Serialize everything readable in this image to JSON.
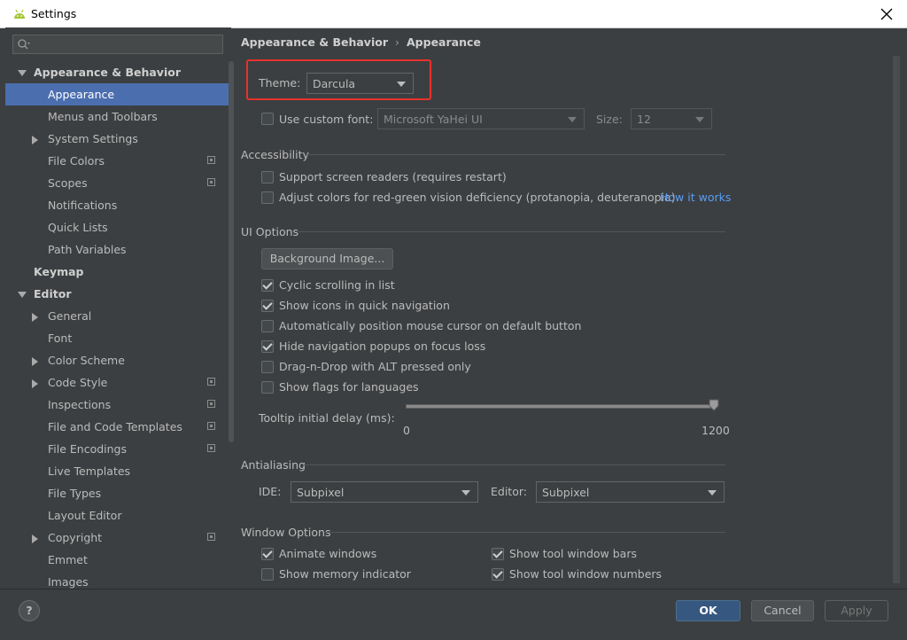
{
  "window": {
    "title": "Settings"
  },
  "sidebar": {
    "search_placeholder": "",
    "items": [
      {
        "label": "Appearance & Behavior",
        "level": 0,
        "arrow": "down",
        "bold": true
      },
      {
        "label": "Appearance",
        "level": 1,
        "selected": true
      },
      {
        "label": "Menus and Toolbars",
        "level": 1
      },
      {
        "label": "System Settings",
        "level": 1,
        "arrow": "right"
      },
      {
        "label": "File Colors",
        "level": 1,
        "project_icon": true
      },
      {
        "label": "Scopes",
        "level": 1,
        "project_icon": true
      },
      {
        "label": "Notifications",
        "level": 1
      },
      {
        "label": "Quick Lists",
        "level": 1
      },
      {
        "label": "Path Variables",
        "level": 1
      },
      {
        "label": "Keymap",
        "level": 0,
        "bold": true
      },
      {
        "label": "Editor",
        "level": 0,
        "arrow": "down",
        "bold": true
      },
      {
        "label": "General",
        "level": 1,
        "arrow": "right"
      },
      {
        "label": "Font",
        "level": 1
      },
      {
        "label": "Color Scheme",
        "level": 1,
        "arrow": "right"
      },
      {
        "label": "Code Style",
        "level": 1,
        "arrow": "right",
        "project_icon": true
      },
      {
        "label": "Inspections",
        "level": 1,
        "project_icon": true
      },
      {
        "label": "File and Code Templates",
        "level": 1,
        "project_icon": true
      },
      {
        "label": "File Encodings",
        "level": 1,
        "project_icon": true
      },
      {
        "label": "Live Templates",
        "level": 1
      },
      {
        "label": "File Types",
        "level": 1
      },
      {
        "label": "Layout Editor",
        "level": 1
      },
      {
        "label": "Copyright",
        "level": 1,
        "arrow": "right",
        "project_icon": true
      },
      {
        "label": "Emmet",
        "level": 1
      },
      {
        "label": "Images",
        "level": 1
      }
    ]
  },
  "breadcrumb": {
    "parent": "Appearance & Behavior",
    "separator": "›",
    "current": "Appearance"
  },
  "theme": {
    "label": "Theme:",
    "value": "Darcula"
  },
  "custom_font": {
    "label": "Use custom font:",
    "checked": false,
    "font_value": "Microsoft YaHei UI",
    "size_label": "Size:",
    "size_value": "12"
  },
  "accessibility": {
    "title": "Accessibility",
    "screen_readers": {
      "label": "Support screen readers (requires restart)",
      "checked": false
    },
    "color_deficiency": {
      "label": "Adjust colors for red-green vision deficiency (protanopia, deuteranopia)",
      "checked": false,
      "link": "How it works"
    }
  },
  "ui_options": {
    "title": "UI Options",
    "background_button": "Background Image...",
    "checkboxes": [
      {
        "label": "Cyclic scrolling in list",
        "checked": true
      },
      {
        "label": "Show icons in quick navigation",
        "checked": true
      },
      {
        "label": "Automatically position mouse cursor on default button",
        "checked": false
      },
      {
        "label": "Hide navigation popups on focus loss",
        "checked": true
      },
      {
        "label": "Drag-n-Drop with ALT pressed only",
        "checked": false
      },
      {
        "label": "Show flags for languages",
        "checked": false
      }
    ],
    "tooltip": {
      "label": "Tooltip initial delay (ms):",
      "min": "0",
      "max": "1200",
      "value": 1200
    }
  },
  "antialiasing": {
    "title": "Antialiasing",
    "ide_label": "IDE:",
    "ide_value": "Subpixel",
    "editor_label": "Editor:",
    "editor_value": "Subpixel"
  },
  "window_options": {
    "title": "Window Options",
    "left": [
      {
        "label": "Animate windows",
        "checked": true
      },
      {
        "label": "Show memory indicator",
        "checked": false
      }
    ],
    "right": [
      {
        "label": "Show tool window bars",
        "checked": true
      },
      {
        "label": "Show tool window numbers",
        "checked": true
      }
    ]
  },
  "footer": {
    "help": "?",
    "ok": "OK",
    "cancel": "Cancel",
    "apply": "Apply"
  },
  "colors": {
    "background": "#3c3f41",
    "selection": "#4b6eaf",
    "link": "#589df6",
    "highlight": "#e8322b",
    "primary_button": "#365880"
  },
  "icons": {
    "app": "android-icon",
    "close": "close-icon",
    "search": "search-icon",
    "help": "help-icon",
    "project": "project-level-icon"
  }
}
